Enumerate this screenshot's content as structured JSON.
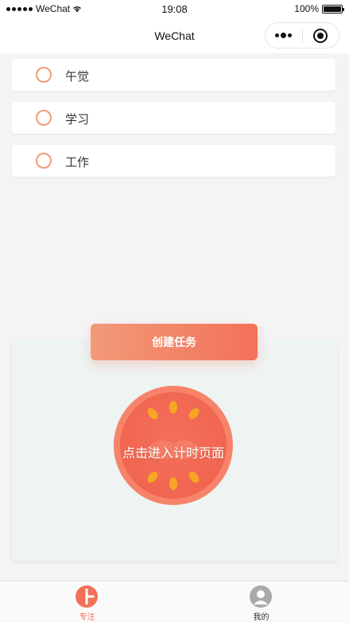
{
  "status_bar": {
    "carrier": "WeChat",
    "time": "19:08",
    "battery": "100%",
    "battery_level": 1.0
  },
  "nav": {
    "title": "WeChat"
  },
  "tasks": [
    {
      "label": "午觉"
    },
    {
      "label": "学习"
    },
    {
      "label": "工作"
    }
  ],
  "create_button": {
    "label": "创建任务"
  },
  "timer": {
    "label": "点击进入计时页面"
  },
  "tab_bar": {
    "tabs": [
      {
        "label": "专注",
        "icon": "focus-icon",
        "active": true
      },
      {
        "label": "我的",
        "icon": "user-icon",
        "active": false
      }
    ]
  },
  "colors": {
    "accent": "#f37159",
    "accent_light": "#f29a79",
    "card_bg": "#eef4f2",
    "page_bg": "#f4f4f4",
    "seed": "#f5a623"
  }
}
